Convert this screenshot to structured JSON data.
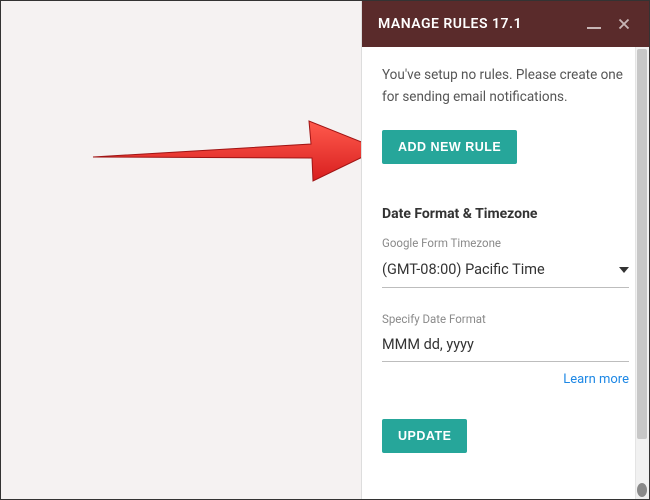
{
  "header": {
    "title": "MANAGE RULES 17.1"
  },
  "intro": "You've setup no rules. Please create one for sending email notifications.",
  "buttons": {
    "add_rule": "ADD NEW RULE",
    "update": "UPDATE"
  },
  "date_section": {
    "heading": "Date Format & Timezone",
    "timezone_label": "Google Form Timezone",
    "timezone_value": "(GMT-08:00) Pacific Time",
    "dateformat_label": "Specify Date Format",
    "dateformat_value": "MMM dd, yyyy",
    "learn_more": "Learn more"
  }
}
